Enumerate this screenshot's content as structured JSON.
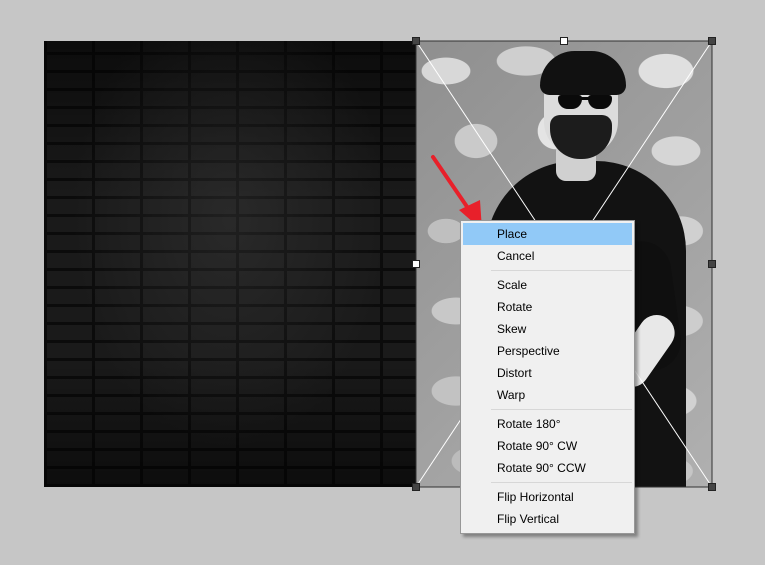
{
  "canvas": {
    "background_document": "dark-brick-wall",
    "placed_image": "man-in-sunglasses-against-stone-wall"
  },
  "context_menu": {
    "items": [
      {
        "label": "Place",
        "highlighted": true
      },
      {
        "label": "Cancel"
      },
      {
        "separator": true
      },
      {
        "label": "Scale"
      },
      {
        "label": "Rotate"
      },
      {
        "label": "Skew"
      },
      {
        "label": "Perspective"
      },
      {
        "label": "Distort"
      },
      {
        "label": "Warp"
      },
      {
        "separator": true
      },
      {
        "label": "Rotate 180°"
      },
      {
        "label": "Rotate 90° CW"
      },
      {
        "label": "Rotate 90° CCW"
      },
      {
        "separator": true
      },
      {
        "label": "Flip Horizontal"
      },
      {
        "label": "Flip Vertical"
      }
    ],
    "labels": {
      "place": "Place",
      "cancel": "Cancel",
      "scale": "Scale",
      "rotate": "Rotate",
      "skew": "Skew",
      "perspective": "Perspective",
      "distort": "Distort",
      "warp": "Warp",
      "rotate_180": "Rotate 180°",
      "rotate_90_cw": "Rotate 90° CW",
      "rotate_90_ccw": "Rotate 90° CCW",
      "flip_horizontal": "Flip Horizontal",
      "flip_vertical": "Flip Vertical"
    }
  },
  "colors": {
    "workspace": "#c6c6c6",
    "menu_background": "#f0f0f0",
    "menu_highlight": "#91c9f7",
    "annotation_arrow": "#e8202a"
  },
  "annotation": {
    "icon": "red-arrow-pointing-to-place"
  }
}
